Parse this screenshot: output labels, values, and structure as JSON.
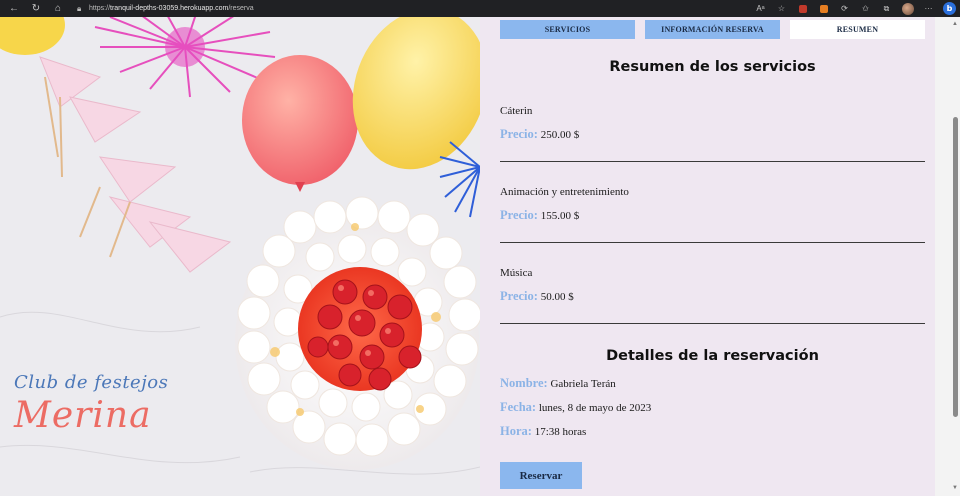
{
  "browser": {
    "url_prefix": "https://",
    "url_host": "tranquil-depths-03059.herokuapp.com",
    "url_path": "/reserva",
    "icons": [
      "back-icon",
      "refresh-icon",
      "home-icon",
      "lock-icon",
      "read-aloud-icon",
      "favorite-icon",
      "extension-icon",
      "rss-icon",
      "refresh-extension-icon",
      "favorites-icon",
      "collections-icon",
      "profile-avatar",
      "more-icon",
      "bing-icon"
    ]
  },
  "brand": {
    "top": "Club de festejos",
    "main": "Merina",
    "colors": {
      "top": "#4b77b8",
      "main": "#ec6c64"
    }
  },
  "tabs": [
    {
      "label": "SERVICIOS",
      "active": false
    },
    {
      "label": "INFORMACIÓN RESERVA",
      "active": false
    },
    {
      "label": "RESUMEN",
      "active": true
    }
  ],
  "summary": {
    "title": "Resumen de los servicios",
    "price_label": "Precio:",
    "services": [
      {
        "name": "Cáterin",
        "price": "250.00 $"
      },
      {
        "name": "Animación y entretenimiento",
        "price": "155.00 $"
      },
      {
        "name": "Música",
        "price": "50.00 $"
      }
    ]
  },
  "details": {
    "title": "Detalles de la reservación",
    "name_label": "Nombre:",
    "name": "Gabriela Terán",
    "date_label": "Fecha:",
    "date": "lunes, 8 de mayo de 2023",
    "time_label": "Hora:",
    "time": "17:38 horas"
  },
  "actions": {
    "reserve_label": "Reservar"
  },
  "colors": {
    "accent": "#8bb7ee",
    "panel_bg": "#efe7f1",
    "label": "#8bb3e6"
  }
}
